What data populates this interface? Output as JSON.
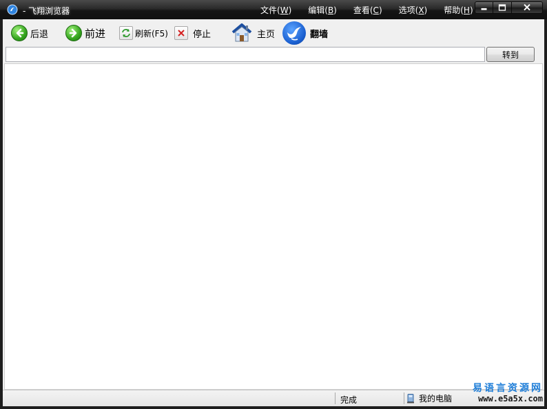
{
  "window": {
    "title": "- 飞翔浏览器",
    "controls": {
      "minimize_icon": "minimize-icon",
      "maximize_icon": "maximize-icon",
      "close_icon": "close-icon"
    }
  },
  "menu": [
    {
      "text": "文件(",
      "accel": "W",
      "close": ")"
    },
    {
      "text": "编辑(",
      "accel": "B",
      "close": ")"
    },
    {
      "text": "查看(",
      "accel": "C",
      "close": ")"
    },
    {
      "text": "选项(",
      "accel": "X",
      "close": ")"
    },
    {
      "text": "帮助(",
      "accel": "H",
      "close": ")"
    }
  ],
  "toolbar": {
    "back_label": "后退",
    "forward_label": "前进",
    "refresh_label": "刷新(F5)",
    "stop_label": "停止",
    "home_label": "主页",
    "fanqiang_label": "翻墙"
  },
  "address": {
    "value": "",
    "placeholder": "",
    "go_label": "转到"
  },
  "status": {
    "text": "完成",
    "zone": "我的电脑"
  },
  "watermark": {
    "cn": "易语言资源网",
    "url": "www.e5a5x.com"
  },
  "colors": {
    "titlebar": "#1e1e1e",
    "toolbar_bg": "#f0f0f0",
    "nav_green": "#35a51e",
    "watermark_blue": "#1f7ed8"
  }
}
